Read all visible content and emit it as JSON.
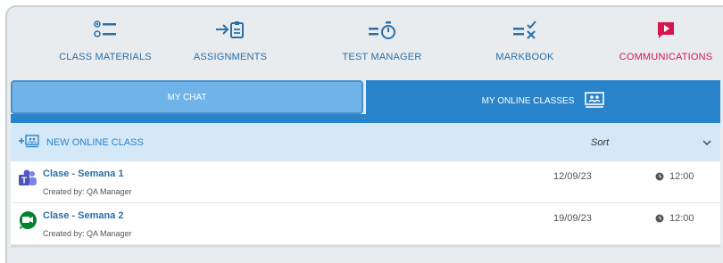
{
  "nav": {
    "items": [
      {
        "label": "CLASS MATERIALS",
        "icon": "list-icon"
      },
      {
        "label": "ASSIGNMENTS",
        "icon": "clipboard-arrow-icon"
      },
      {
        "label": "TEST MANAGER",
        "icon": "timer-icon"
      },
      {
        "label": "MARKBOOK",
        "icon": "markbook-icon"
      },
      {
        "label": "COMMUNICATIONS",
        "icon": "play-message-icon",
        "active": true
      }
    ]
  },
  "tabs": {
    "chat": "MY CHAT",
    "online_classes": "MY ONLINE CLASSES"
  },
  "toolbar": {
    "new_class": "NEW ONLINE CLASS",
    "sort": "Sort"
  },
  "classes": [
    {
      "title": "Clase - Semana 1",
      "created_by": "Created by: QA Manager",
      "date": "12/09/23",
      "time": "12:00",
      "app": "teams"
    },
    {
      "title": "Clase - Semana 2",
      "created_by": "Created by: QA Manager",
      "date": "19/09/23",
      "time": "12:00",
      "app": "meet"
    }
  ],
  "colors": {
    "accent": "#2a84cc",
    "active_nav": "#d6174f",
    "tab_inactive": "#6fb3e8",
    "toolbar_bg": "#d4e8f7"
  }
}
